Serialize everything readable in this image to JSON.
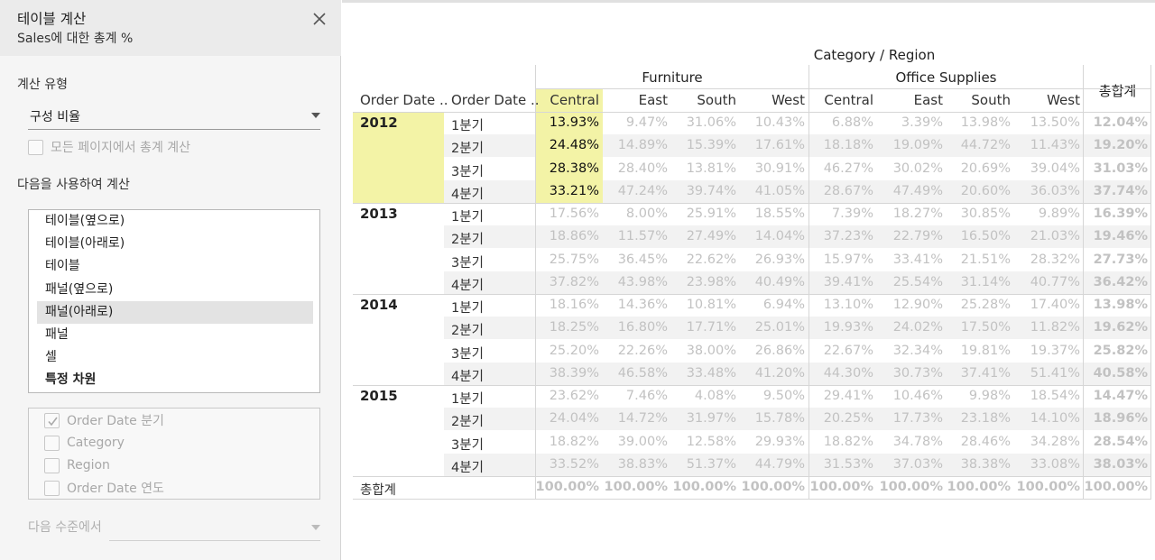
{
  "panel": {
    "title": "테이블 계산",
    "subtitle": "Sales에 대한 총계 %",
    "calc_type_label": "계산 유형",
    "calc_type_value": "구성 비율",
    "all_pages_label": "모든 페이지에서 총계 계산",
    "compute_using_label": "다음을 사용하여 계산",
    "compute_options": [
      {
        "label": "테이블(옆으로)",
        "selected": false,
        "bold": false
      },
      {
        "label": "테이블(아래로)",
        "selected": false,
        "bold": false
      },
      {
        "label": "테이블",
        "selected": false,
        "bold": false
      },
      {
        "label": "패널(옆으로)",
        "selected": false,
        "bold": false
      },
      {
        "label": "패널(아래로)",
        "selected": true,
        "bold": false
      },
      {
        "label": "패널",
        "selected": false,
        "bold": false
      },
      {
        "label": "셀",
        "selected": false,
        "bold": false
      },
      {
        "label": "특정 차원",
        "selected": false,
        "bold": true
      }
    ],
    "dimensions": [
      {
        "label": "Order Date 분기",
        "checked": true
      },
      {
        "label": "Category",
        "checked": false
      },
      {
        "label": "Region",
        "checked": false
      },
      {
        "label": "Order Date 연도",
        "checked": false
      }
    ],
    "next_level_label": "다음 수준에서",
    "icons": {
      "close": "close-icon",
      "dropdown": "chevron-down-icon",
      "check": "check-icon"
    }
  },
  "table": {
    "column_title": "Category / Region",
    "row_header_1": "Order Date ..",
    "row_header_2": "Order Date ..",
    "grand_total_label": "총합계",
    "grand_total_column": "총합계",
    "categories": [
      {
        "name": "Furniture",
        "regions": [
          "Central",
          "East",
          "South",
          "West"
        ]
      },
      {
        "name": "Office Supplies",
        "regions": [
          "Central",
          "East",
          "South",
          "West"
        ]
      }
    ],
    "highlight_color": "#f3f3a6",
    "years": [
      {
        "year": "2012",
        "quarters": [
          {
            "q": "1분기",
            "v": [
              "13.93%",
              "9.47%",
              "31.06%",
              "10.43%",
              "6.88%",
              "3.39%",
              "13.98%",
              "13.50%"
            ],
            "total": "12.04%"
          },
          {
            "q": "2분기",
            "v": [
              "24.48%",
              "14.89%",
              "15.39%",
              "17.61%",
              "18.18%",
              "19.09%",
              "44.72%",
              "11.43%"
            ],
            "total": "19.20%"
          },
          {
            "q": "3분기",
            "v": [
              "28.38%",
              "28.40%",
              "13.81%",
              "30.91%",
              "46.27%",
              "30.02%",
              "20.69%",
              "39.04%"
            ],
            "total": "31.03%"
          },
          {
            "q": "4분기",
            "v": [
              "33.21%",
              "47.24%",
              "39.74%",
              "41.05%",
              "28.67%",
              "47.49%",
              "20.60%",
              "36.03%"
            ],
            "total": "37.74%"
          }
        ]
      },
      {
        "year": "2013",
        "quarters": [
          {
            "q": "1분기",
            "v": [
              "17.56%",
              "8.00%",
              "25.91%",
              "18.55%",
              "7.39%",
              "18.27%",
              "30.85%",
              "9.89%"
            ],
            "total": "16.39%"
          },
          {
            "q": "2분기",
            "v": [
              "18.86%",
              "11.57%",
              "27.49%",
              "14.04%",
              "37.23%",
              "22.79%",
              "16.50%",
              "21.03%"
            ],
            "total": "19.46%"
          },
          {
            "q": "3분기",
            "v": [
              "25.75%",
              "36.45%",
              "22.62%",
              "26.93%",
              "15.97%",
              "33.41%",
              "21.51%",
              "28.32%"
            ],
            "total": "27.73%"
          },
          {
            "q": "4분기",
            "v": [
              "37.82%",
              "43.98%",
              "23.98%",
              "40.49%",
              "39.41%",
              "25.54%",
              "31.14%",
              "40.77%"
            ],
            "total": "36.42%"
          }
        ]
      },
      {
        "year": "2014",
        "quarters": [
          {
            "q": "1분기",
            "v": [
              "18.16%",
              "14.36%",
              "10.81%",
              "6.94%",
              "13.10%",
              "12.90%",
              "25.28%",
              "17.40%"
            ],
            "total": "13.98%"
          },
          {
            "q": "2분기",
            "v": [
              "18.25%",
              "16.80%",
              "17.71%",
              "25.01%",
              "19.93%",
              "24.02%",
              "17.50%",
              "11.82%"
            ],
            "total": "19.62%"
          },
          {
            "q": "3분기",
            "v": [
              "25.20%",
              "22.26%",
              "38.00%",
              "26.86%",
              "22.67%",
              "32.34%",
              "19.81%",
              "19.37%"
            ],
            "total": "25.82%"
          },
          {
            "q": "4분기",
            "v": [
              "38.39%",
              "46.58%",
              "33.48%",
              "41.20%",
              "44.30%",
              "30.73%",
              "37.41%",
              "51.41%"
            ],
            "total": "40.58%"
          }
        ]
      },
      {
        "year": "2015",
        "quarters": [
          {
            "q": "1분기",
            "v": [
              "23.62%",
              "7.46%",
              "4.08%",
              "9.50%",
              "29.41%",
              "10.46%",
              "9.98%",
              "18.54%"
            ],
            "total": "14.47%"
          },
          {
            "q": "2분기",
            "v": [
              "24.04%",
              "14.72%",
              "31.97%",
              "15.78%",
              "20.25%",
              "17.73%",
              "23.18%",
              "14.10%"
            ],
            "total": "18.96%"
          },
          {
            "q": "3분기",
            "v": [
              "18.82%",
              "39.00%",
              "12.58%",
              "29.93%",
              "18.82%",
              "34.78%",
              "28.46%",
              "34.28%"
            ],
            "total": "28.54%"
          },
          {
            "q": "4분기",
            "v": [
              "33.52%",
              "38.83%",
              "51.37%",
              "44.79%",
              "31.53%",
              "37.03%",
              "38.38%",
              "33.08%"
            ],
            "total": "38.03%"
          }
        ]
      }
    ],
    "grand_totals": [
      "100.00%",
      "100.00%",
      "100.00%",
      "100.00%",
      "100.00%",
      "100.00%",
      "100.00%",
      "100.00%"
    ],
    "grand_total_total": "100.00%"
  }
}
